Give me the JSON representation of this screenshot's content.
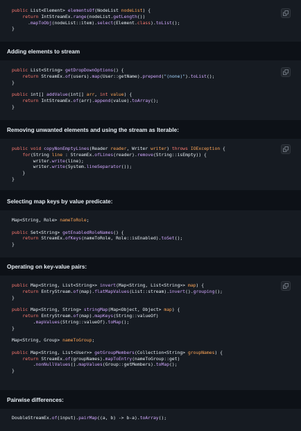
{
  "headings": [
    "Adding elements to stream",
    "Removing unwanted elements and using the stream as Iterable:",
    "Selecting map keys by value predicate:",
    "Operating on key-value pairs:",
    "Pairwise differences:"
  ],
  "copy_button": {
    "icon": "copy-icon",
    "tooltip": "Copy"
  },
  "colors": {
    "background": "#0d1117",
    "code_background": "#161b22",
    "keyword": "#ff7b72",
    "function": "#d2a8ff",
    "string": "#a5d6ff",
    "variable": "#ffa657",
    "constant": "#79c0ff",
    "text": "#e6edf3"
  },
  "code_blocks": [
    {
      "lines": [
        [
          [
            "kw",
            "public "
          ],
          [
            "pl",
            "List<Element> "
          ],
          [
            "fn",
            "elementsOf"
          ],
          [
            "pl",
            "(NodeList "
          ],
          [
            "var",
            "nodeList"
          ],
          [
            "pl",
            ") {"
          ]
        ],
        [
          [
            "pl",
            "    "
          ],
          [
            "kw",
            "return "
          ],
          [
            "pl",
            "IntStreamEx."
          ],
          [
            "fn",
            "range"
          ],
          [
            "pl",
            "(nodeList."
          ],
          [
            "fn",
            "getLength"
          ],
          [
            "pl",
            "())"
          ]
        ],
        [
          [
            "pl",
            "      ."
          ],
          [
            "fn",
            "mapToObj"
          ],
          [
            "pl",
            "(nodeList::item)."
          ],
          [
            "fn",
            "select"
          ],
          [
            "pl",
            "(Element."
          ],
          [
            "kw",
            "class"
          ],
          [
            "pl",
            ")."
          ],
          [
            "fn",
            "toList"
          ],
          [
            "pl",
            "();"
          ]
        ],
        [
          [
            "pl",
            "}"
          ]
        ]
      ]
    },
    {
      "lines": [
        [
          [
            "kw",
            "public "
          ],
          [
            "pl",
            "List<String> "
          ],
          [
            "fn",
            "getDropDownOptions"
          ],
          [
            "pl",
            "() {"
          ]
        ],
        [
          [
            "pl",
            "    "
          ],
          [
            "kw",
            "return "
          ],
          [
            "pl",
            "StreamEx."
          ],
          [
            "fn",
            "of"
          ],
          [
            "pl",
            "(users)."
          ],
          [
            "fn",
            "map"
          ],
          [
            "pl",
            "(User::getName)."
          ],
          [
            "fn",
            "prepend"
          ],
          [
            "pl",
            "("
          ],
          [
            "str",
            "\"(none)\""
          ],
          [
            "pl",
            ")."
          ],
          [
            "fn",
            "toList"
          ],
          [
            "pl",
            "();"
          ]
        ],
        [
          [
            "pl",
            "}"
          ]
        ],
        [],
        [
          [
            "kw",
            "public "
          ],
          [
            "pl",
            "int[] "
          ],
          [
            "fn",
            "addValue"
          ],
          [
            "pl",
            "(int[] "
          ],
          [
            "var",
            "arr"
          ],
          [
            "pl",
            ", "
          ],
          [
            "kw",
            "int "
          ],
          [
            "var",
            "value"
          ],
          [
            "pl",
            ") {"
          ]
        ],
        [
          [
            "pl",
            "    "
          ],
          [
            "kw",
            "return "
          ],
          [
            "pl",
            "IntStreamEx."
          ],
          [
            "fn",
            "of"
          ],
          [
            "pl",
            "(arr)."
          ],
          [
            "fn",
            "append"
          ],
          [
            "pl",
            "(value)."
          ],
          [
            "fn",
            "toArray"
          ],
          [
            "pl",
            "();"
          ]
        ],
        [
          [
            "pl",
            "}"
          ]
        ]
      ]
    },
    {
      "lines": [
        [
          [
            "kw",
            "public void "
          ],
          [
            "fn",
            "copyNonEmptyLines"
          ],
          [
            "pl",
            "(Reader "
          ],
          [
            "var",
            "reader"
          ],
          [
            "pl",
            ", Writer "
          ],
          [
            "var",
            "writer"
          ],
          [
            "pl",
            ") "
          ],
          [
            "kw",
            "throws "
          ],
          [
            "var",
            "IOException"
          ],
          [
            "pl",
            " {"
          ]
        ],
        [
          [
            "pl",
            "    "
          ],
          [
            "kw",
            "for"
          ],
          [
            "pl",
            "(String "
          ],
          [
            "var",
            "line"
          ],
          [
            "pl",
            " : StreamEx."
          ],
          [
            "fn",
            "ofLines"
          ],
          [
            "pl",
            "(reader)."
          ],
          [
            "fn",
            "remove"
          ],
          [
            "pl",
            "(String::isEmpty)) {"
          ]
        ],
        [
          [
            "pl",
            "        writer."
          ],
          [
            "fn",
            "write"
          ],
          [
            "pl",
            "(line);"
          ]
        ],
        [
          [
            "pl",
            "        writer."
          ],
          [
            "fn",
            "write"
          ],
          [
            "pl",
            "(System."
          ],
          [
            "fn",
            "lineSeparator"
          ],
          [
            "pl",
            "());"
          ]
        ],
        [
          [
            "pl",
            "    }"
          ]
        ],
        [
          [
            "pl",
            "}"
          ]
        ]
      ]
    },
    {
      "lines": [
        [
          [
            "pl",
            "Map<String, Role> "
          ],
          [
            "var",
            "nameToRole"
          ],
          [
            "pl",
            ";"
          ]
        ],
        [],
        [
          [
            "kw",
            "public "
          ],
          [
            "pl",
            "Set<String> "
          ],
          [
            "fn",
            "getEnabledRoleNames"
          ],
          [
            "pl",
            "() {"
          ]
        ],
        [
          [
            "pl",
            "    "
          ],
          [
            "kw",
            "return "
          ],
          [
            "pl",
            "StreamEx."
          ],
          [
            "fn",
            "ofKeys"
          ],
          [
            "pl",
            "(nameToRole, Role::isEnabled)."
          ],
          [
            "fn",
            "toSet"
          ],
          [
            "pl",
            "();"
          ]
        ],
        [
          [
            "pl",
            "}"
          ]
        ]
      ]
    },
    {
      "lines": [
        [
          [
            "kw",
            "public "
          ],
          [
            "pl",
            "Map<String, List<String>> "
          ],
          [
            "fn",
            "invert"
          ],
          [
            "pl",
            "(Map<String, List<String>> "
          ],
          [
            "var",
            "map"
          ],
          [
            "pl",
            ") {"
          ]
        ],
        [
          [
            "pl",
            "    "
          ],
          [
            "kw",
            "return "
          ],
          [
            "pl",
            "EntryStream."
          ],
          [
            "fn",
            "of"
          ],
          [
            "pl",
            "(map)."
          ],
          [
            "fn",
            "flatMapValues"
          ],
          [
            "pl",
            "(List::stream)."
          ],
          [
            "fn",
            "invert"
          ],
          [
            "pl",
            "()."
          ],
          [
            "fn",
            "grouping"
          ],
          [
            "pl",
            "();"
          ]
        ],
        [
          [
            "pl",
            "}"
          ]
        ],
        [],
        [
          [
            "kw",
            "public "
          ],
          [
            "pl",
            "Map<String, String> "
          ],
          [
            "fn",
            "stringMap"
          ],
          [
            "pl",
            "(Map<Object, Object> "
          ],
          [
            "var",
            "map"
          ],
          [
            "pl",
            ") {"
          ]
        ],
        [
          [
            "pl",
            "    "
          ],
          [
            "kw",
            "return "
          ],
          [
            "pl",
            "EntryStream."
          ],
          [
            "fn",
            "of"
          ],
          [
            "pl",
            "(map)."
          ],
          [
            "fn",
            "mapKeys"
          ],
          [
            "pl",
            "(String::valueOf)"
          ]
        ],
        [
          [
            "pl",
            "        ."
          ],
          [
            "fn",
            "mapValues"
          ],
          [
            "pl",
            "(String::valueOf)."
          ],
          [
            "fn",
            "toMap"
          ],
          [
            "pl",
            "();"
          ]
        ],
        [
          [
            "pl",
            "}"
          ]
        ],
        [],
        [
          [
            "pl",
            "Map<String, Group> "
          ],
          [
            "var",
            "nameToGroup"
          ],
          [
            "pl",
            ";"
          ]
        ],
        [],
        [
          [
            "kw",
            "public "
          ],
          [
            "pl",
            "Map<String, List<User>> "
          ],
          [
            "fn",
            "getGroupMembers"
          ],
          [
            "pl",
            "(Collection<String> "
          ],
          [
            "var",
            "groupNames"
          ],
          [
            "pl",
            ") {"
          ]
        ],
        [
          [
            "pl",
            "    "
          ],
          [
            "kw",
            "return "
          ],
          [
            "pl",
            "StreamEx."
          ],
          [
            "fn",
            "of"
          ],
          [
            "pl",
            "(groupNames)."
          ],
          [
            "fn",
            "mapToEntry"
          ],
          [
            "pl",
            "(nameToGroup::get)"
          ]
        ],
        [
          [
            "pl",
            "        ."
          ],
          [
            "fn",
            "nonNullValues"
          ],
          [
            "pl",
            "()."
          ],
          [
            "fn",
            "mapValues"
          ],
          [
            "pl",
            "(Group::getMembers)."
          ],
          [
            "fn",
            "toMap"
          ],
          [
            "pl",
            "();"
          ]
        ],
        [
          [
            "pl",
            "}"
          ]
        ]
      ]
    },
    {
      "lines": [
        [
          [
            "pl",
            "DoubleStreamEx."
          ],
          [
            "fn",
            "of"
          ],
          [
            "pl",
            "(input)."
          ],
          [
            "fn",
            "pairMap"
          ],
          [
            "pl",
            "((a, b) -> b-a)."
          ],
          [
            "fn",
            "toArray"
          ],
          [
            "pl",
            "();"
          ]
        ]
      ]
    }
  ]
}
